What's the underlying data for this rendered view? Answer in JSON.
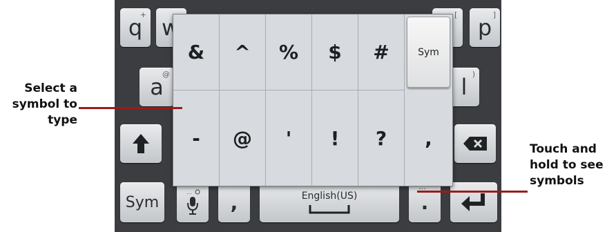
{
  "callouts": {
    "left_line1": "Select a",
    "left_line2": "symbol to",
    "left_line3": "type",
    "right_line1": "Touch and",
    "right_line2": "hold to see",
    "right_line3": "symbols"
  },
  "keyboard": {
    "row1": {
      "q": "q",
      "q_hint": "+",
      "w": "w",
      "p": "p",
      "p_hint": "]",
      "o_hint": "["
    },
    "row2": {
      "a": "a",
      "a_hint": "@",
      "l": "l",
      "l_hint": ")"
    },
    "bottom": {
      "sym_label": "Sym",
      "comma_label": ",",
      "space_label": "English(US)",
      "period_label": ".",
      "period_hint": "..."
    }
  },
  "popup": {
    "row1": [
      "&",
      "^",
      "%",
      "$",
      "#"
    ],
    "row2": [
      "-",
      "@",
      "'",
      "!",
      "?",
      ","
    ],
    "sym_button": "Sym"
  },
  "colors": {
    "callout_line": "#9b1b1b",
    "keyboard_bg": "#3b3d40"
  }
}
